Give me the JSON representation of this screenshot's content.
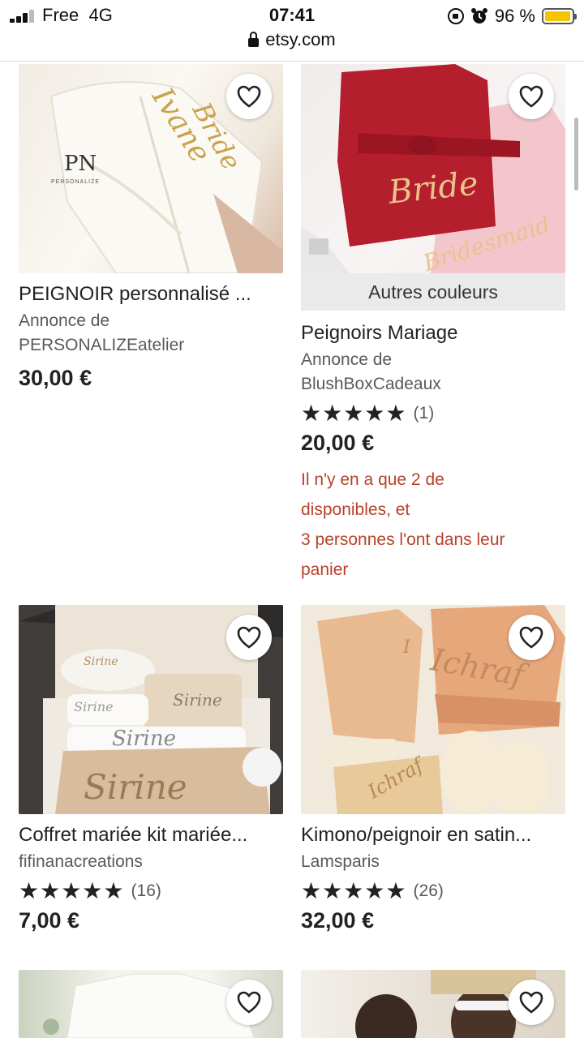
{
  "status_bar": {
    "carrier": "Free",
    "network": "4G",
    "time": "07:41",
    "battery_percent": "96 %",
    "battery_level": 0.96
  },
  "browser": {
    "url": "etsy.com"
  },
  "listings": [
    {
      "title": "PEIGNOIR personnalisé ...",
      "shop_line1": "Annonce de",
      "shop_line2": "PERSONALIZEatelier",
      "price": "30,00 €",
      "image_text": [
        "Bride",
        "Ivane",
        "PN",
        "PERSONALIZE"
      ]
    },
    {
      "badge": "Autres couleurs",
      "title": "Peignoirs Mariage",
      "shop_line1": "Annonce de",
      "shop_line2": "BlushBoxCadeaux",
      "stars": "★★★★★",
      "reviews": "(1)",
      "price": "20,00 €",
      "stock_lines": [
        "Il n'y en a que 2 de",
        "disponibles, et",
        "3 personnes l'ont dans leur",
        "panier"
      ],
      "image_text": [
        "Bride",
        "Bridesmaid"
      ]
    },
    {
      "title": "Coffret mariée kit mariée...",
      "shop": "fifinanacreations",
      "stars": "★★★★★",
      "reviews": "(16)",
      "price": "7,00 €",
      "image_text": [
        "Sirine",
        "Sirine",
        "Sirine",
        "Sirine",
        "Sirine"
      ]
    },
    {
      "title": "Kimono/peignoir en satin...",
      "shop": "Lamsparis",
      "stars": "★★★★★",
      "reviews": "(26)",
      "price": "32,00 €",
      "image_text": [
        "Ichraf",
        "Ichraf",
        "I"
      ]
    }
  ],
  "colors": {
    "stock_warning": "#b8412a",
    "badge_bg": "#eaeaea",
    "battery": "#f5c400"
  }
}
